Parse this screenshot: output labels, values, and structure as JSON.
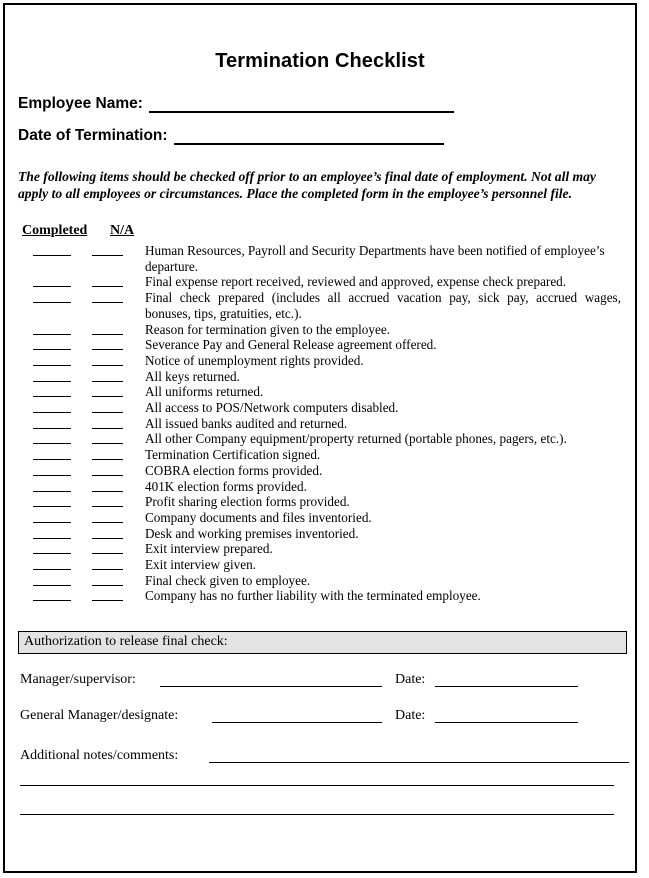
{
  "document": {
    "title": "Termination Checklist",
    "fields": [
      {
        "label": "Employee Name:",
        "value": ""
      },
      {
        "label": "Date of Termination:",
        "value": ""
      }
    ],
    "instructions": "The following items should be checked off prior to an employee’s final date of employment. Not all may apply to all employees or circumstances. Place the completed form in the employee’s personnel file.",
    "columns": {
      "completed": "Completed",
      "na": "N/A"
    },
    "checklist": [
      "Human Resources, Payroll and Security Departments have been notified of employee’s departure.",
      "Final expense report received, reviewed and approved, expense check prepared.",
      "Final check prepared (includes all accrued vacation pay, sick pay, accrued wages, bonuses, tips, gratuities, etc.).",
      "Reason for termination given to the employee.",
      "Severance Pay and General Release agreement offered.",
      "Notice of unemployment rights provided.",
      "All keys returned.",
      "All uniforms returned.",
      "All access to POS/Network computers disabled.",
      "All issued banks audited and returned.",
      "All other Company equipment/property returned (portable phones, pagers, etc.).",
      "Termination Certification signed.",
      "COBRA election forms provided.",
      "401K election forms provided.",
      "Profit sharing election forms provided.",
      "Company documents and files inventoried.",
      "Desk and working premises inventoried.",
      "Exit interview prepared.",
      "Exit interview given.",
      "Final check given to employee.",
      "Company has no further liability with the terminated employee."
    ],
    "authorization": {
      "banner": "Authorization to release final check:",
      "rows": [
        {
          "label": "Manager/supervisor:",
          "date_label": "Date:",
          "value": "",
          "date_value": ""
        },
        {
          "label": "General Manager/designate:",
          "date_label": "Date:",
          "value": "",
          "date_value": ""
        }
      ]
    },
    "notes": {
      "label": "Additional notes/comments:",
      "value": "",
      "extra_lines": 2
    },
    "colors": {
      "banner_fill": "#e3e3e3",
      "border": "#000000",
      "text": "#000000"
    }
  }
}
